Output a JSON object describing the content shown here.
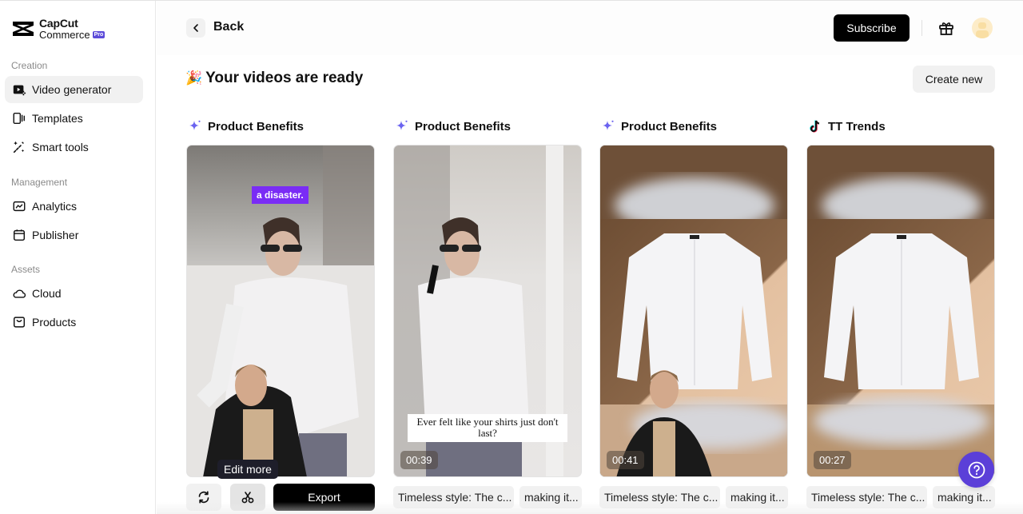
{
  "app": {
    "brand_line1": "CapCut",
    "brand_line2": "Commerce",
    "brand_badge": "Pro"
  },
  "sidebar": {
    "sections": [
      {
        "label": "Creation"
      },
      {
        "label": "Management"
      },
      {
        "label": "Assets"
      }
    ],
    "items": [
      {
        "label": "Video generator",
        "icon": "video-plus-icon",
        "active": true
      },
      {
        "label": "Templates",
        "icon": "templates-icon"
      },
      {
        "label": "Smart tools",
        "icon": "magic-wand-icon"
      },
      {
        "label": "Analytics",
        "icon": "analytics-chart-icon"
      },
      {
        "label": "Publisher",
        "icon": "calendar-icon"
      },
      {
        "label": "Cloud",
        "icon": "cloud-icon"
      },
      {
        "label": "Products",
        "icon": "product-box-icon"
      }
    ]
  },
  "header": {
    "back_label": "Back",
    "subscribe_label": "Subscribe",
    "gift_icon": "gift-icon",
    "avatar_icon": "user-avatar-icon"
  },
  "main": {
    "title_emoji": "🎉",
    "title": "Your videos are ready",
    "create_new_label": "Create new",
    "cards": [
      {
        "title": "Product Benefits",
        "icon": "sparkle-icon",
        "caption": "a disaster.",
        "has_actions": true,
        "tooltip": "Edit more",
        "export_label": "Export"
      },
      {
        "title": "Product Benefits",
        "icon": "sparkle-icon",
        "caption": "Ever felt like your shirts just don't last?",
        "duration": "00:39",
        "chips": [
          "Timeless style: The c...",
          "making it..."
        ]
      },
      {
        "title": "Product Benefits",
        "icon": "sparkle-icon",
        "duration": "00:41",
        "chips": [
          "Timeless style: The c...",
          "making it..."
        ]
      },
      {
        "title": "TT Trends",
        "icon": "tiktok-icon",
        "duration": "00:27",
        "chips": [
          "Timeless style: The c...",
          "making it..."
        ]
      }
    ]
  },
  "colors": {
    "accent": "#5b3fd8",
    "sparkle": "#6b63f0",
    "caption_purple": "#7a2cf5",
    "primary_button": "#000000"
  }
}
